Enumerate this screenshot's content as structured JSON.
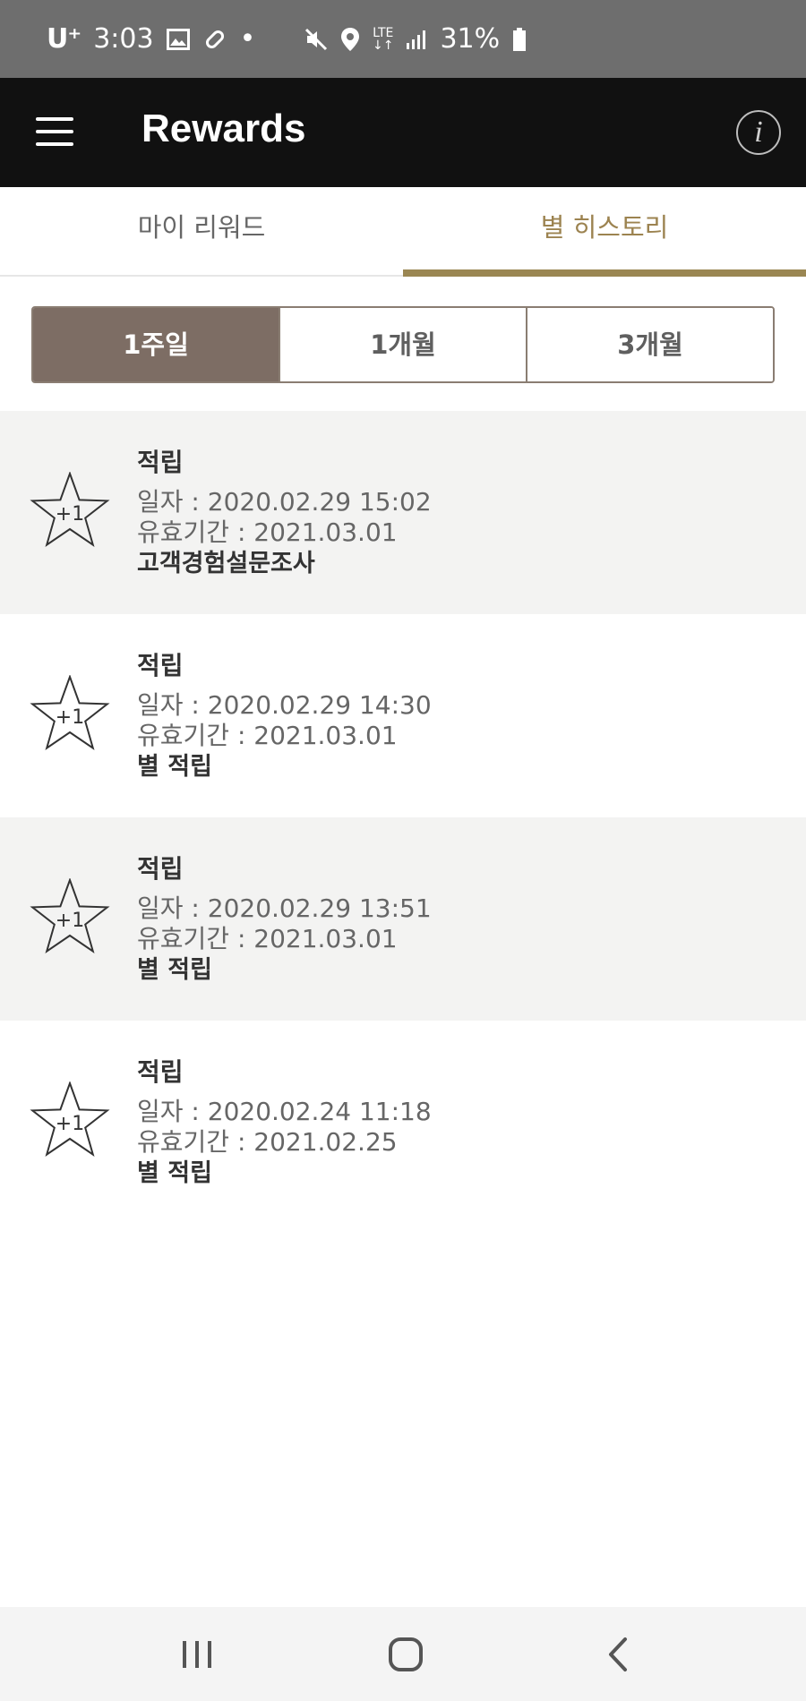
{
  "status_bar": {
    "carrier": "U⁺",
    "time": "3:03",
    "dot": "•",
    "lte_top": "LTE",
    "lte_bottom": "↓↑",
    "battery_percent": "31%"
  },
  "app_bar": {
    "title": "Rewards",
    "info_label": "i"
  },
  "tabs": [
    {
      "label": "마이 리워드",
      "selected": false
    },
    {
      "label": "별 히스토리",
      "selected": true
    }
  ],
  "period_filter": [
    {
      "label": "1주일",
      "selected": true
    },
    {
      "label": "1개월",
      "selected": false
    },
    {
      "label": "3개월",
      "selected": false
    }
  ],
  "history": [
    {
      "badge": "+1",
      "type": "적립",
      "date": "일자 : 2020.02.29 15:02",
      "expiry": "유효기간 : 2021.03.01",
      "description": "고객경험설문조사"
    },
    {
      "badge": "+1",
      "type": "적립",
      "date": "일자 : 2020.02.29 14:30",
      "expiry": "유효기간 : 2021.03.01",
      "description": "별 적립"
    },
    {
      "badge": "+1",
      "type": "적립",
      "date": "일자 : 2020.02.29 13:51",
      "expiry": "유효기간 : 2021.03.01",
      "description": "별 적립"
    },
    {
      "badge": "+1",
      "type": "적립",
      "date": "일자 : 2020.02.24 11:18",
      "expiry": "유효기간 : 2021.02.25",
      "description": "별 적립"
    }
  ],
  "icons": {
    "menu": "hamburger-menu-icon",
    "info": "info-icon",
    "star": "star-outline-icon",
    "nav_recent": "recent-apps-icon",
    "nav_home": "home-icon",
    "nav_back": "back-icon"
  },
  "colors": {
    "app_bar_bg": "#111111",
    "accent_gold": "#9a8652",
    "segment_active_bg": "#7d6d64",
    "shaded_row_bg": "#f3f3f2"
  }
}
